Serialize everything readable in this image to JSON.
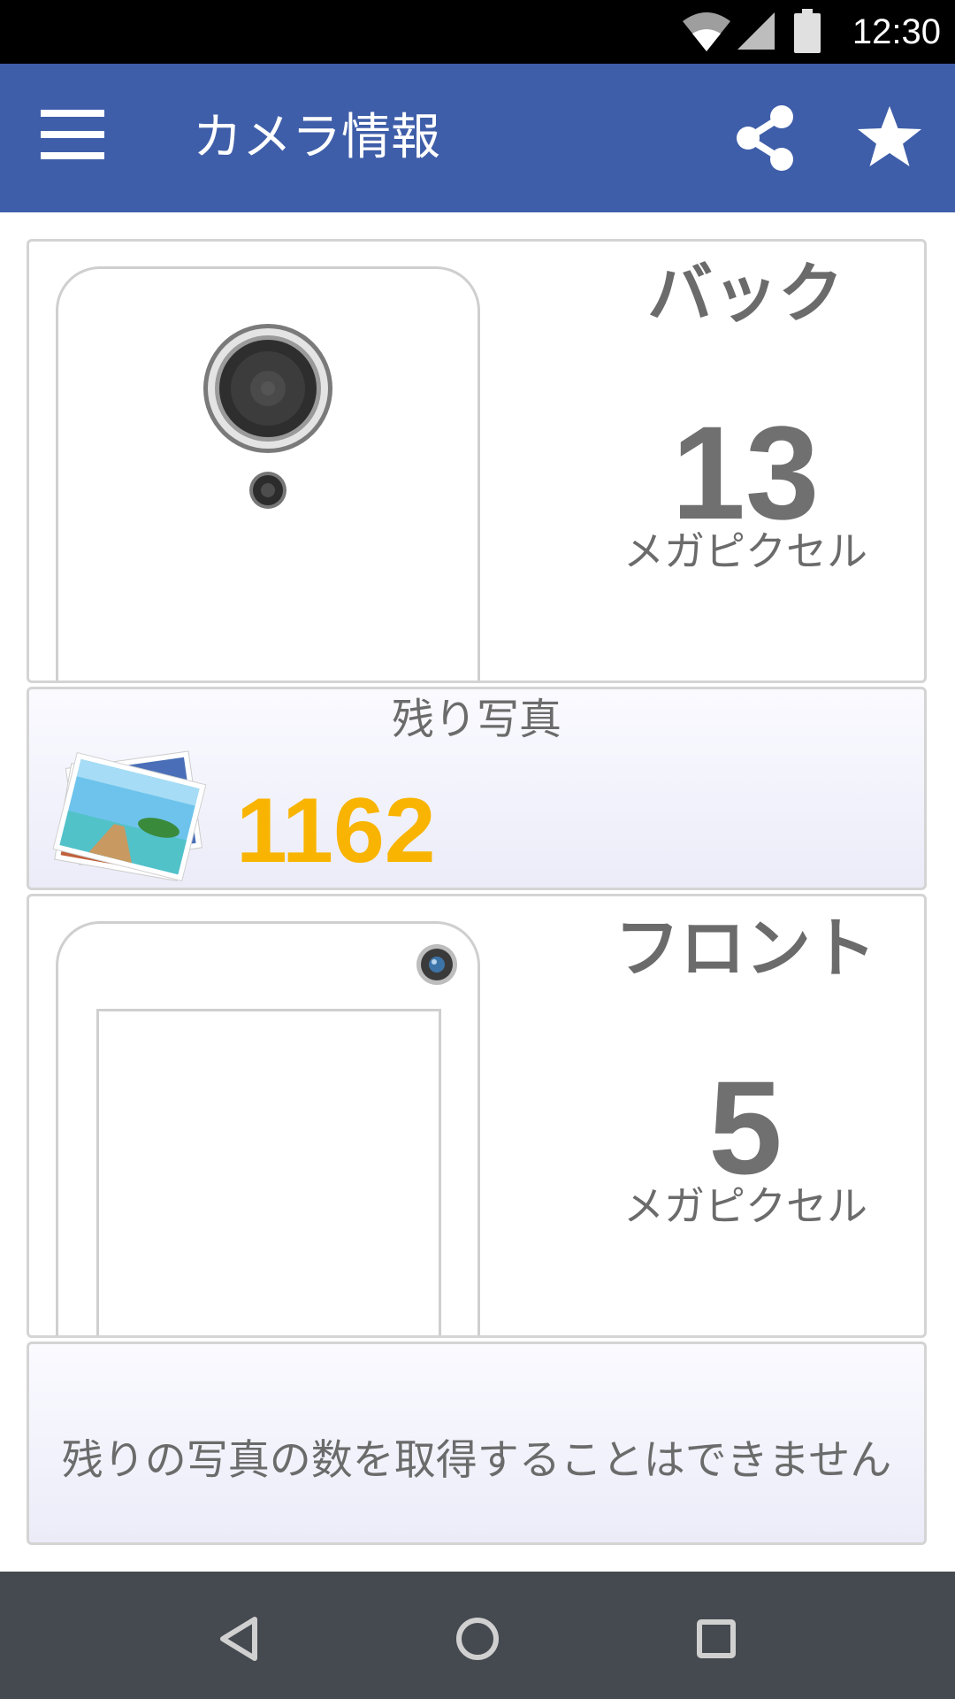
{
  "status_bar": {
    "time": "12:30",
    "icons": [
      "wifi-icon",
      "cellular-signal-icon",
      "battery-icon"
    ]
  },
  "app_bar": {
    "title": "カメラ情報",
    "background_color": "#3f5ea9",
    "icons": [
      "menu-icon",
      "share-icon",
      "star-icon"
    ]
  },
  "back_camera": {
    "label": "バック",
    "megapixels": "13",
    "unit": "メガピクセル"
  },
  "back_remaining": {
    "label": "残り写真",
    "count": "1162",
    "count_color": "#f8b400"
  },
  "front_camera": {
    "label": "フロント",
    "megapixels": "5",
    "unit": "メガピクセル"
  },
  "front_remaining": {
    "message": "残りの写真の数を取得することはできません"
  },
  "nav_bar": {
    "buttons": [
      "back-icon",
      "home-icon",
      "recents-icon"
    ]
  }
}
